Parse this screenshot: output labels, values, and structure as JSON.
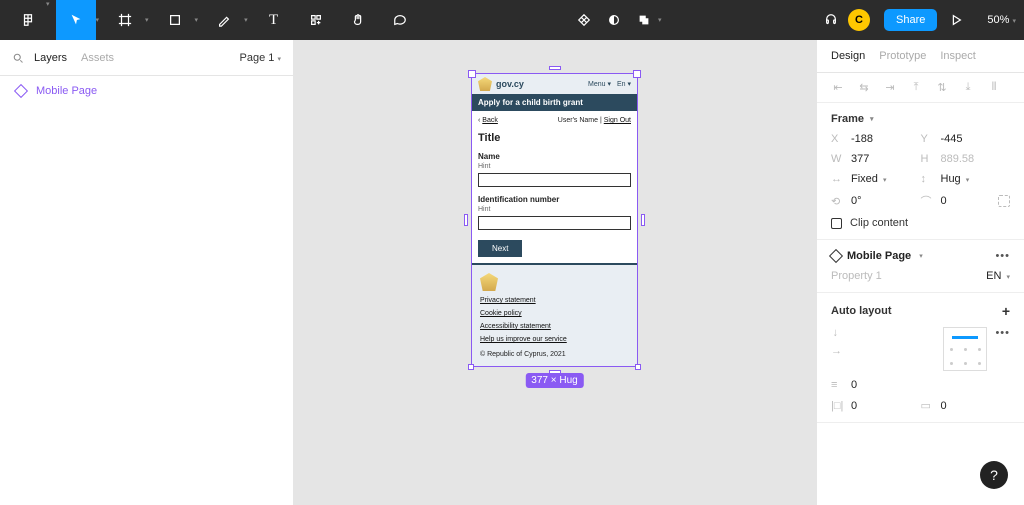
{
  "toolbar": {
    "zoom": "50%",
    "share": "Share",
    "avatar_letter": "C"
  },
  "left": {
    "tab_layers": "Layers",
    "tab_assets": "Assets",
    "page_picker": "Page 1",
    "layer_name": "Mobile Page"
  },
  "canvas": {
    "dims_badge": "377 × Hug"
  },
  "mobile": {
    "brand": "gov.cy",
    "menu": "Menu ▾",
    "lang": "En ▾",
    "banner": "Apply for a child birth grant",
    "back": "Back",
    "user_signout": "User's Name | ",
    "signout": "Sign Out",
    "title": "Title",
    "name_label": "Name",
    "hint1": "Hint",
    "id_label": "Identification number",
    "hint2": "Hint",
    "next": "Next",
    "footer_links": [
      "Privacy statement",
      "Cookie policy",
      "Accessibility statement",
      "Help us improve our service"
    ],
    "copyright": "© Republic of Cyprus, 2021"
  },
  "design": {
    "tab_design": "Design",
    "tab_prototype": "Prototype",
    "tab_inspect": "Inspect",
    "frame_section": "Frame",
    "x_label": "X",
    "x_val": "-188",
    "y_label": "Y",
    "y_val": "-445",
    "w_label": "W",
    "w_val": "377",
    "h_label": "H",
    "h_val": "889.58",
    "horiz_mode": "Fixed",
    "vert_mode": "Hug",
    "rot": "0°",
    "radius": "0",
    "clip": "Clip content",
    "variant_name": "Mobile Page",
    "prop_label": "Property 1",
    "prop_value": "EN",
    "auto_layout": "Auto layout",
    "gap": "0",
    "pad_v": "0",
    "pad_h": "0"
  }
}
